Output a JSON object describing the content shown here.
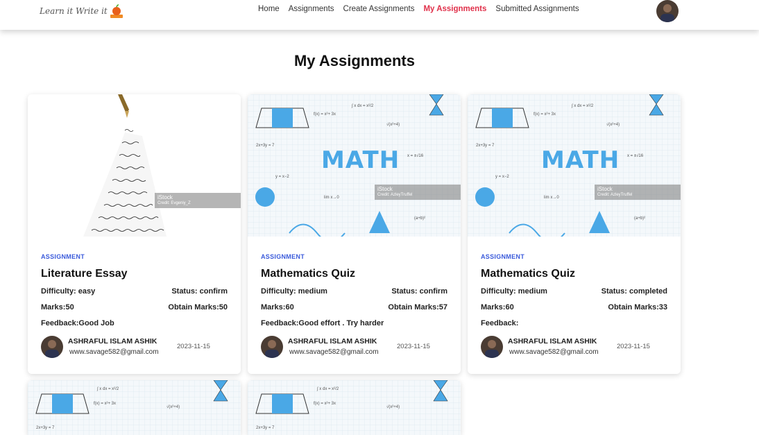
{
  "nav": {
    "logo_text": "Learn it Write it",
    "links": [
      "Home",
      "Assignments",
      "Create Assignments",
      "My Assignments",
      "Submitted Assignments"
    ],
    "active": "My Assignments"
  },
  "page": {
    "title": "My Assignments"
  },
  "cards": [
    {
      "tag": "ASSIGNMENT",
      "title": "Literature Essay",
      "difficulty": "Difficulty: easy",
      "status": "Status: confirm",
      "marks": "Marks:50",
      "obtain": "Obtain Marks:50",
      "feedback": "Feedback:Good Job",
      "author_name": "ASHRAFUL ISLAM ASHIK",
      "author_email": "www.savage582@gmail.com",
      "date": "2023-11-15",
      "watermark": "iStock",
      "watermark_credit": "Credit: Evgeniy_Z"
    },
    {
      "tag": "ASSIGNMENT",
      "title": "Mathematics Quiz",
      "difficulty": "Difficulty: medium",
      "status": "Status: confirm",
      "marks": "Marks:60",
      "obtain": "Obtain Marks:57",
      "feedback": "Feedback:Good effort . Try harder",
      "author_name": "ASHRAFUL ISLAM ASHIK",
      "author_email": "www.savage582@gmail.com",
      "date": "2023-11-15",
      "image_word": "MATH",
      "watermark": "iStock",
      "watermark_credit": "Credit: AzleyTruffel"
    },
    {
      "tag": "ASSIGNMENT",
      "title": "Mathematics Quiz",
      "difficulty": "Difficulty: medium",
      "status": "Status: completed",
      "marks": "Marks:60",
      "obtain": "Obtain Marks:33",
      "feedback": "Feedback:",
      "author_name": "ASHRAFUL ISLAM ASHIK",
      "author_email": "www.savage582@gmail.com",
      "date": "2023-11-15",
      "image_word": "MATH",
      "watermark": "iStock",
      "watermark_credit": "Credit: AzleyTruffel"
    }
  ],
  "colors": {
    "active_nav": "#e0304a",
    "tag": "#3b5bdb",
    "math_blue": "#4aa8e6"
  }
}
